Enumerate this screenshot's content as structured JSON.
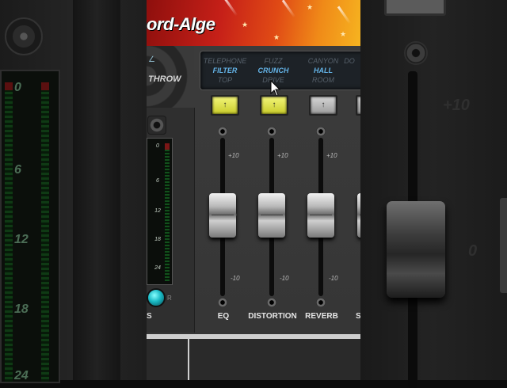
{
  "header": {
    "brand": "ord-Alge"
  },
  "throw": {
    "label": "THROW"
  },
  "presets": {
    "columns": [
      {
        "top": "TELEPHONE",
        "selected": "FILTER",
        "bottom": "TOP"
      },
      {
        "top": "FUZZ",
        "selected": "CRUNCH",
        "bottom": "DRIVE"
      },
      {
        "top": "CANYON",
        "selected": "HALL",
        "bottom": "ROOM"
      },
      {
        "top": "DO",
        "selected": "",
        "bottom": ""
      }
    ]
  },
  "meter": {
    "scale": [
      "0",
      "6",
      "12",
      "18",
      "24"
    ],
    "s_label": "S",
    "r_label": "R"
  },
  "fader_scale": {
    "plus10": "+10",
    "zero": "0",
    "minus10": "-10"
  },
  "channels": [
    {
      "name": "EQ",
      "button_state": "on",
      "button_icon": "↑"
    },
    {
      "name": "DISTORTION",
      "button_state": "on",
      "button_icon": "↑"
    },
    {
      "name": "REVERB",
      "button_state": "off",
      "button_icon": "↑"
    },
    {
      "name": "SH",
      "button_state": "off",
      "button_icon": ""
    }
  ],
  "background": {
    "left_scale": [
      "0",
      "6",
      "12",
      "18",
      "24"
    ],
    "right_scale": [
      "+10",
      "0"
    ]
  },
  "colors": {
    "accent_blue": "#64b4e8",
    "button_on": "#e8ea55",
    "meter_green": "#12501c",
    "knob_cyan": "#19b9c4"
  }
}
